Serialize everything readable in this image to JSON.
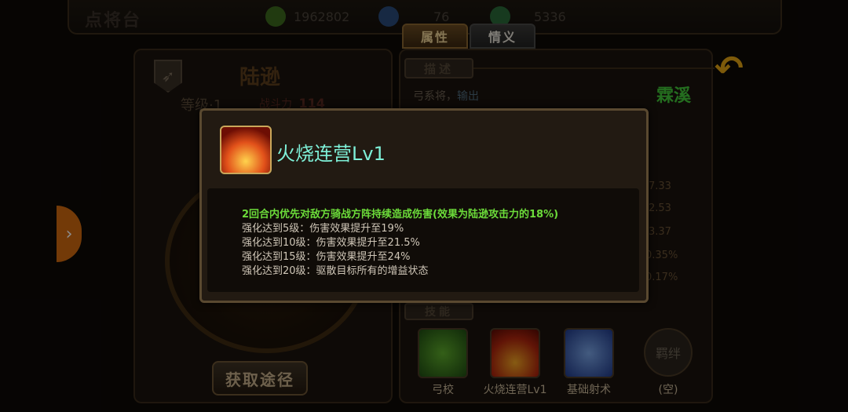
{
  "top_bar": {
    "title": "点将台",
    "resources": [
      {
        "icon": "coin-plus-icon",
        "value": "1962802",
        "color": "#3c6b1e"
      },
      {
        "icon": "blue-gem-icon",
        "value": "76",
        "color": "#2a4c7a"
      },
      {
        "icon": "green-orb-icon",
        "value": "5336",
        "color": "#2a6a3a"
      }
    ]
  },
  "tabs": [
    {
      "label": "属性",
      "active": true
    },
    {
      "label": "情义",
      "active": false
    }
  ],
  "hero": {
    "name": "陆逊",
    "level": "等级·1",
    "power_label": "战斗力",
    "power_value": "114",
    "obtain_button": "获取途径"
  },
  "right_panel": {
    "desc_header": "描述",
    "class_prefix": "弓系将，",
    "class_highlight": "输出",
    "author": "霖溪",
    "stats": [
      "7.33",
      "2.53",
      "3.37",
      "0.35%",
      "0.17%"
    ],
    "skills_header": "技能",
    "skills": [
      {
        "label": "弓校",
        "icon": "bow-captain-icon"
      },
      {
        "label": "火烧连营Lv1",
        "icon": "fire-camp-icon"
      },
      {
        "label": "基础射术",
        "icon": "basic-archery-icon"
      },
      {
        "label": "(空)",
        "icon": "bond-icon",
        "icon_text": "羁绊"
      }
    ]
  },
  "side_tab_arrow": "›",
  "back_arrow": "↶",
  "popup": {
    "title": "火烧连营Lv1",
    "main_effect": "2回合内优先对敌方骑战方阵持续造成伤害(效果为陆逊攻击力的18%)",
    "upgrades": [
      "强化达到5级：伤害效果提升至19%",
      "强化达到10级：伤害效果提升至21.5%",
      "强化达到15级：伤害效果提升至24%",
      "强化达到20级：驱散目标所有的增益状态"
    ]
  }
}
